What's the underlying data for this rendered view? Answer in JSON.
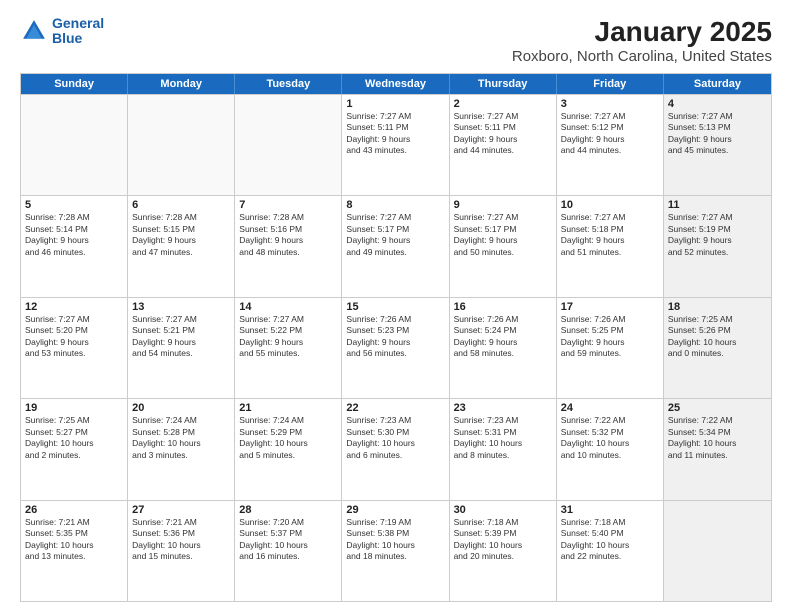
{
  "header": {
    "logo_line1": "General",
    "logo_line2": "Blue",
    "title": "January 2025",
    "subtitle": "Roxboro, North Carolina, United States"
  },
  "weekdays": [
    "Sunday",
    "Monday",
    "Tuesday",
    "Wednesday",
    "Thursday",
    "Friday",
    "Saturday"
  ],
  "rows": [
    [
      {
        "day": "",
        "text": "",
        "empty": true
      },
      {
        "day": "",
        "text": "",
        "empty": true
      },
      {
        "day": "",
        "text": "",
        "empty": true
      },
      {
        "day": "1",
        "text": "Sunrise: 7:27 AM\nSunset: 5:11 PM\nDaylight: 9 hours\nand 43 minutes."
      },
      {
        "day": "2",
        "text": "Sunrise: 7:27 AM\nSunset: 5:11 PM\nDaylight: 9 hours\nand 44 minutes."
      },
      {
        "day": "3",
        "text": "Sunrise: 7:27 AM\nSunset: 5:12 PM\nDaylight: 9 hours\nand 44 minutes."
      },
      {
        "day": "4",
        "text": "Sunrise: 7:27 AM\nSunset: 5:13 PM\nDaylight: 9 hours\nand 45 minutes.",
        "shaded": true
      }
    ],
    [
      {
        "day": "5",
        "text": "Sunrise: 7:28 AM\nSunset: 5:14 PM\nDaylight: 9 hours\nand 46 minutes."
      },
      {
        "day": "6",
        "text": "Sunrise: 7:28 AM\nSunset: 5:15 PM\nDaylight: 9 hours\nand 47 minutes."
      },
      {
        "day": "7",
        "text": "Sunrise: 7:28 AM\nSunset: 5:16 PM\nDaylight: 9 hours\nand 48 minutes."
      },
      {
        "day": "8",
        "text": "Sunrise: 7:27 AM\nSunset: 5:17 PM\nDaylight: 9 hours\nand 49 minutes."
      },
      {
        "day": "9",
        "text": "Sunrise: 7:27 AM\nSunset: 5:17 PM\nDaylight: 9 hours\nand 50 minutes."
      },
      {
        "day": "10",
        "text": "Sunrise: 7:27 AM\nSunset: 5:18 PM\nDaylight: 9 hours\nand 51 minutes."
      },
      {
        "day": "11",
        "text": "Sunrise: 7:27 AM\nSunset: 5:19 PM\nDaylight: 9 hours\nand 52 minutes.",
        "shaded": true
      }
    ],
    [
      {
        "day": "12",
        "text": "Sunrise: 7:27 AM\nSunset: 5:20 PM\nDaylight: 9 hours\nand 53 minutes."
      },
      {
        "day": "13",
        "text": "Sunrise: 7:27 AM\nSunset: 5:21 PM\nDaylight: 9 hours\nand 54 minutes."
      },
      {
        "day": "14",
        "text": "Sunrise: 7:27 AM\nSunset: 5:22 PM\nDaylight: 9 hours\nand 55 minutes."
      },
      {
        "day": "15",
        "text": "Sunrise: 7:26 AM\nSunset: 5:23 PM\nDaylight: 9 hours\nand 56 minutes."
      },
      {
        "day": "16",
        "text": "Sunrise: 7:26 AM\nSunset: 5:24 PM\nDaylight: 9 hours\nand 58 minutes."
      },
      {
        "day": "17",
        "text": "Sunrise: 7:26 AM\nSunset: 5:25 PM\nDaylight: 9 hours\nand 59 minutes."
      },
      {
        "day": "18",
        "text": "Sunrise: 7:25 AM\nSunset: 5:26 PM\nDaylight: 10 hours\nand 0 minutes.",
        "shaded": true
      }
    ],
    [
      {
        "day": "19",
        "text": "Sunrise: 7:25 AM\nSunset: 5:27 PM\nDaylight: 10 hours\nand 2 minutes."
      },
      {
        "day": "20",
        "text": "Sunrise: 7:24 AM\nSunset: 5:28 PM\nDaylight: 10 hours\nand 3 minutes."
      },
      {
        "day": "21",
        "text": "Sunrise: 7:24 AM\nSunset: 5:29 PM\nDaylight: 10 hours\nand 5 minutes."
      },
      {
        "day": "22",
        "text": "Sunrise: 7:23 AM\nSunset: 5:30 PM\nDaylight: 10 hours\nand 6 minutes."
      },
      {
        "day": "23",
        "text": "Sunrise: 7:23 AM\nSunset: 5:31 PM\nDaylight: 10 hours\nand 8 minutes."
      },
      {
        "day": "24",
        "text": "Sunrise: 7:22 AM\nSunset: 5:32 PM\nDaylight: 10 hours\nand 10 minutes."
      },
      {
        "day": "25",
        "text": "Sunrise: 7:22 AM\nSunset: 5:34 PM\nDaylight: 10 hours\nand 11 minutes.",
        "shaded": true
      }
    ],
    [
      {
        "day": "26",
        "text": "Sunrise: 7:21 AM\nSunset: 5:35 PM\nDaylight: 10 hours\nand 13 minutes."
      },
      {
        "day": "27",
        "text": "Sunrise: 7:21 AM\nSunset: 5:36 PM\nDaylight: 10 hours\nand 15 minutes."
      },
      {
        "day": "28",
        "text": "Sunrise: 7:20 AM\nSunset: 5:37 PM\nDaylight: 10 hours\nand 16 minutes."
      },
      {
        "day": "29",
        "text": "Sunrise: 7:19 AM\nSunset: 5:38 PM\nDaylight: 10 hours\nand 18 minutes."
      },
      {
        "day": "30",
        "text": "Sunrise: 7:18 AM\nSunset: 5:39 PM\nDaylight: 10 hours\nand 20 minutes."
      },
      {
        "day": "31",
        "text": "Sunrise: 7:18 AM\nSunset: 5:40 PM\nDaylight: 10 hours\nand 22 minutes."
      },
      {
        "day": "",
        "text": "",
        "empty": true,
        "shaded": true
      }
    ]
  ]
}
